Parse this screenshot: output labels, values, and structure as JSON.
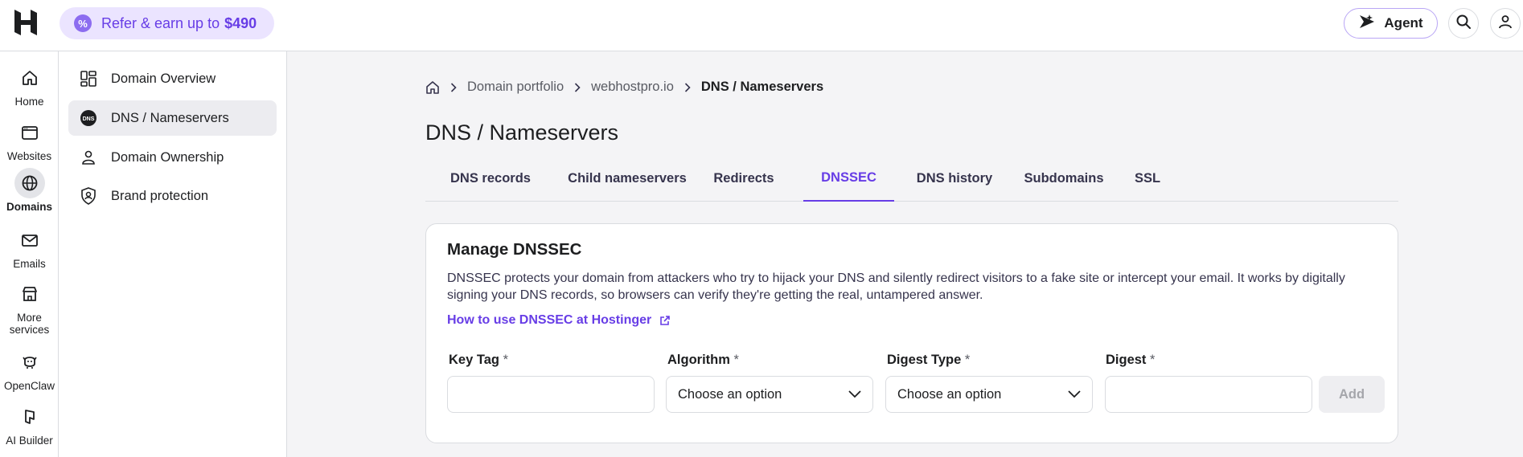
{
  "topbar": {
    "refer_text": "Refer & earn up to",
    "refer_amount": "$490",
    "agent_label": "Agent"
  },
  "rail": {
    "items": [
      {
        "label": "Home",
        "icon": "home-icon"
      },
      {
        "label": "Websites",
        "icon": "browser-icon"
      },
      {
        "label": "Domains",
        "icon": "globe-icon",
        "active": true
      },
      {
        "label": "Emails",
        "icon": "mail-icon"
      },
      {
        "label": "More",
        "label2": "services",
        "icon": "store-icon"
      },
      {
        "label": "OpenClaw",
        "icon": "claw-icon"
      },
      {
        "label": "AI Builder",
        "icon": "ai-builder-icon"
      }
    ]
  },
  "sidebar": {
    "items": [
      {
        "label": "Domain Overview",
        "icon": "overview-icon"
      },
      {
        "label": "DNS / Nameservers",
        "icon": "dns-icon",
        "active": true
      },
      {
        "label": "Domain Ownership",
        "icon": "person-icon"
      },
      {
        "label": "Brand protection",
        "icon": "shield-icon"
      }
    ]
  },
  "breadcrumb": {
    "items": [
      "Domain portfolio",
      "webhostpro.io",
      "DNS / Nameservers"
    ]
  },
  "page": {
    "title": "DNS / Nameservers"
  },
  "tabs": [
    {
      "label": "DNS records"
    },
    {
      "label": "Child nameservers"
    },
    {
      "label": "Redirects"
    },
    {
      "label": "DNSSEC",
      "active": true
    },
    {
      "label": "DNS history"
    },
    {
      "label": "Subdomains"
    },
    {
      "label": "SSL"
    }
  ],
  "dnssec": {
    "title": "Manage DNSSEC",
    "description": "DNSSEC protects your domain from attackers who try to hijack your DNS and silently redirect visitors to a fake site or intercept your email. It works by digitally signing your DNS records, so browsers can verify they're getting the real, untampered answer.",
    "howto_link": "How to use DNSSEC at Hostinger",
    "fields": {
      "key_tag_label": "Key Tag",
      "algorithm_label": "Algorithm",
      "digest_type_label": "Digest Type",
      "digest_label": "Digest",
      "required_mark": "*",
      "algorithm_value": "Choose an option",
      "digest_type_value": "Choose an option",
      "key_tag_value": "",
      "digest_value": ""
    },
    "add_label": "Add"
  },
  "colors": {
    "accent": "#673de6",
    "refer_bg": "#ebe4ff"
  }
}
